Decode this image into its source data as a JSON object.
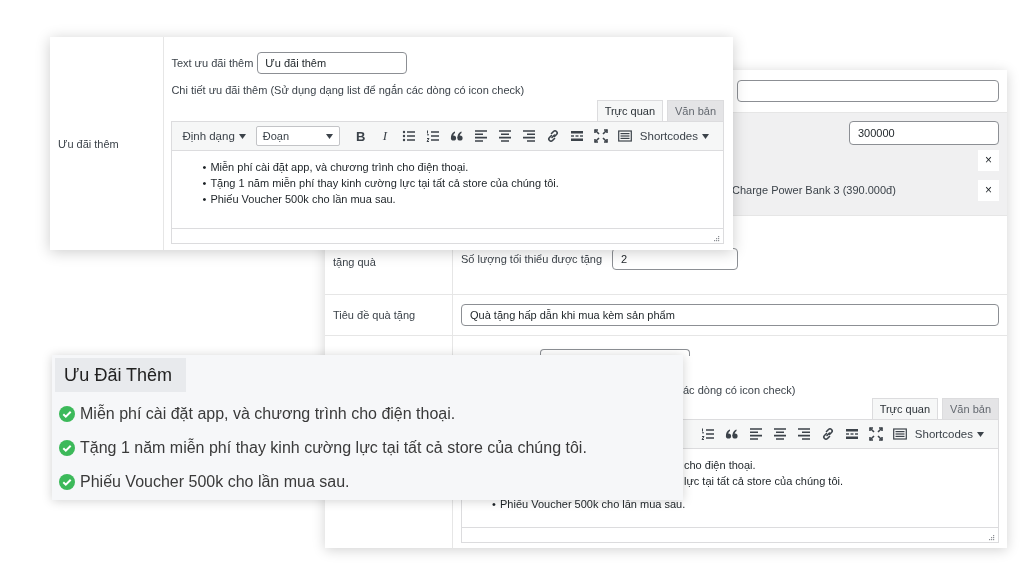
{
  "settings_form": {
    "price_field": {
      "value": "300000"
    },
    "gift_products": [
      {
        "remove": "×"
      },
      {
        "name": "Charge Power Bank 3 (390.000đ)",
        "remove": "×"
      }
    ],
    "condition": {
      "label": "tặng quà",
      "quantity_label": "Số lượng tối thiểu được tặng",
      "quantity_value": "2"
    },
    "gift_title": {
      "label": "Tiêu đề quà tặng",
      "value": "Quà tặng hấp dẫn khi mua kèm sản phẩm"
    },
    "extra_offer": {
      "hint": "ác dòng có icon check)",
      "editor": {
        "tabs": [
          {
            "label": "Trực quan",
            "selected": true
          },
          {
            "label": "Văn bản",
            "selected": false
          }
        ],
        "toolbar": [
          {
            "kind": "numbers"
          },
          {
            "kind": "quote"
          },
          {
            "kind": "align-left"
          },
          {
            "kind": "align-center"
          },
          {
            "kind": "align-right"
          },
          {
            "kind": "link"
          },
          {
            "kind": "more"
          },
          {
            "kind": "fullscreen"
          },
          {
            "kind": "keyboard"
          },
          {
            "kind": "menu",
            "label": "Shortcodes"
          }
        ],
        "lines": [
          {
            "kind": "fragment",
            "text": "cho điện thoại."
          },
          {
            "kind": "fragment",
            "text": "lực tại tất cả store của chúng tôi."
          },
          {
            "kind": "bullet",
            "marker": "•",
            "text": "Phiếu Voucher 500k cho lần mua sau."
          }
        ]
      }
    }
  },
  "offer_form": {
    "label": "Ưu đãi thêm",
    "text_label": "Text ưu đãi thêm",
    "text_value": "Ưu đãi thêm",
    "detail_label": "Chi tiết ưu đãi thêm (Sử dụng dạng list để ngắn các dòng có icon check)",
    "editor": {
      "tabs": [
        {
          "label": "Trực quan",
          "selected": true
        },
        {
          "label": "Văn bản",
          "selected": false
        }
      ],
      "toolbar": [
        {
          "kind": "menu",
          "label": "Định dạng"
        },
        {
          "kind": "select",
          "label": "Đoạn"
        },
        {
          "kind": "bold",
          "label": "B"
        },
        {
          "kind": "italic",
          "label": "I"
        },
        {
          "kind": "bullets"
        },
        {
          "kind": "numbers"
        },
        {
          "kind": "quote"
        },
        {
          "kind": "align-left"
        },
        {
          "kind": "align-center"
        },
        {
          "kind": "align-right"
        },
        {
          "kind": "link"
        },
        {
          "kind": "more"
        },
        {
          "kind": "fullscreen"
        },
        {
          "kind": "keyboard"
        },
        {
          "kind": "menu",
          "label": "Shortcodes"
        }
      ],
      "lines": [
        {
          "kind": "bullet",
          "marker": "•",
          "text": "Miễn phí cài đặt app, và chương trình cho điện thoại."
        },
        {
          "kind": "bullet",
          "marker": "•",
          "text": "Tặng 1 năm miễn phí thay kinh cường lực tại tất cả store của chúng tôi."
        },
        {
          "kind": "bullet",
          "marker": "•",
          "text": "Phiếu Voucher 500k cho lần mua sau."
        }
      ]
    }
  },
  "offer_preview": {
    "title": "Ưu Đãi Thêm",
    "items": [
      "Miễn phí cài đặt app, và chương trình cho điện thoại.",
      "Tặng 1 năm miễn phí thay kinh cường lực tại tất cả store của chúng tôi.",
      "Phiếu Voucher 500k cho lần mua sau."
    ]
  }
}
